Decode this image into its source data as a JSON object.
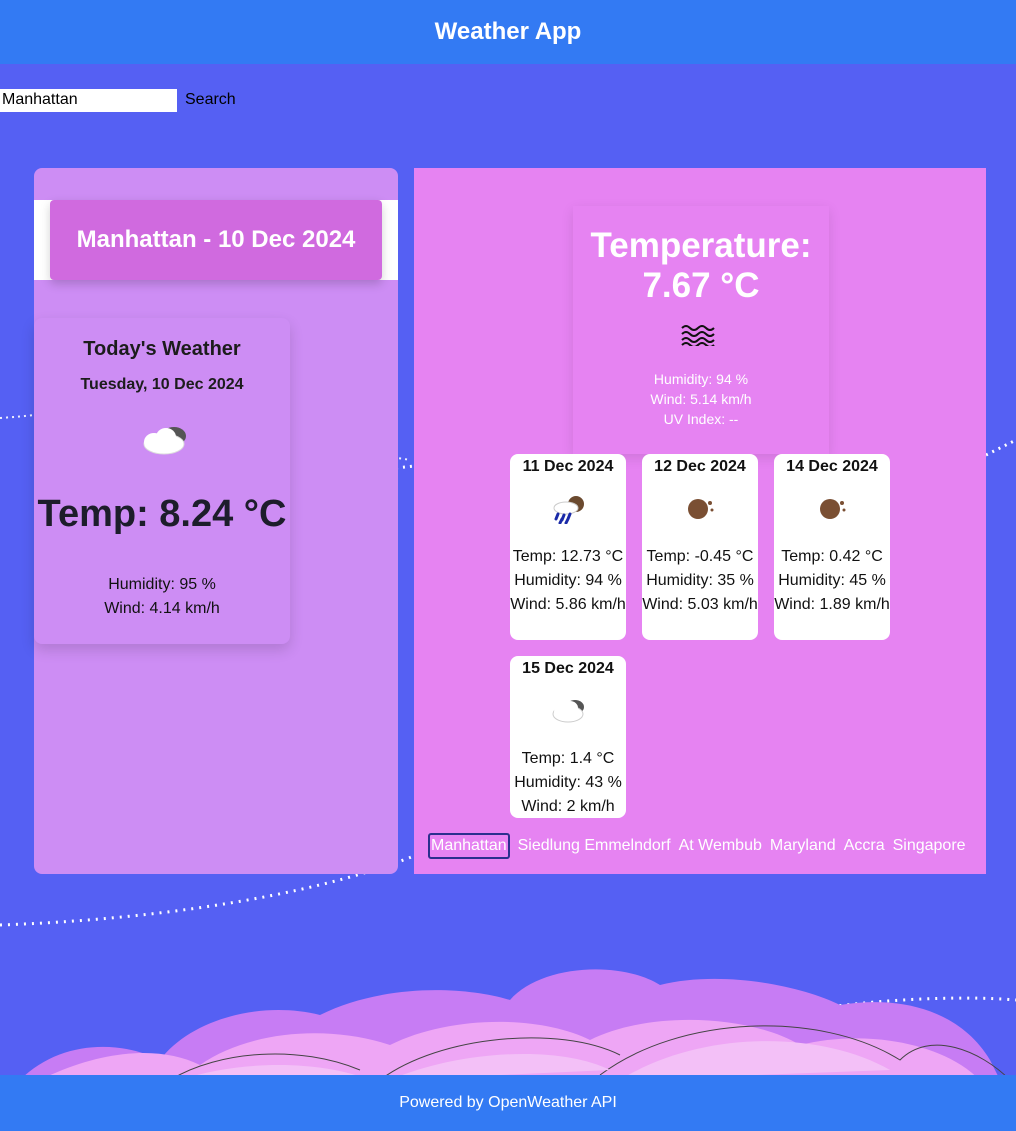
{
  "header": {
    "title": "Weather App"
  },
  "search": {
    "value": "Manhattan",
    "button_label": "Search"
  },
  "left_panel": {
    "banner": "Manhattan - 10 Dec 2024",
    "today": {
      "title": "Today's Weather",
      "date": "Tuesday, 10 Dec 2024",
      "icon": "cloud-icon",
      "temp": "Temp: 8.24 °C",
      "humidity": "Humidity: 95 %",
      "wind": "Wind: 4.14 km/h"
    }
  },
  "current": {
    "temperature": "Temperature: 7.67 °C",
    "icon": "mist-icon",
    "humidity": "Humidity: 94 %",
    "wind": "Wind: 5.14 km/h",
    "uv": "UV Index: --"
  },
  "forecast": [
    {
      "date": "11 Dec 2024",
      "icon": "rain-icon",
      "temp": "Temp: 12.73 °C",
      "humidity": "Humidity: 94 %",
      "wind": "Wind: 5.86 km/h"
    },
    {
      "date": "12 Dec 2024",
      "icon": "clear-night-icon",
      "temp": "Temp: -0.45 °C",
      "humidity": "Humidity: 35 %",
      "wind": "Wind: 5.03 km/h"
    },
    {
      "date": "14 Dec 2024",
      "icon": "clear-night-icon",
      "temp": "Temp: 0.42 °C",
      "humidity": "Humidity: 45 %",
      "wind": "Wind: 1.89 km/h"
    },
    {
      "date": "15 Dec 2024",
      "icon": "cloud-icon",
      "temp": "Temp: 1.4 °C",
      "humidity": "Humidity: 43 %",
      "wind": "Wind: 2 km/h"
    }
  ],
  "city_tabs": [
    "Manhattan",
    "Siedlung Emmelndorf",
    "At Wembub",
    "Maryland",
    "Accra",
    "Singapore"
  ],
  "active_city": "Manhattan",
  "footer": {
    "text": "Powered by OpenWeather API"
  },
  "colors": {
    "background": "#5560f3",
    "bars": "#337af3",
    "left_panel": "#cd8df4",
    "right_panel": "#e683f2",
    "banner": "#d06adf"
  }
}
